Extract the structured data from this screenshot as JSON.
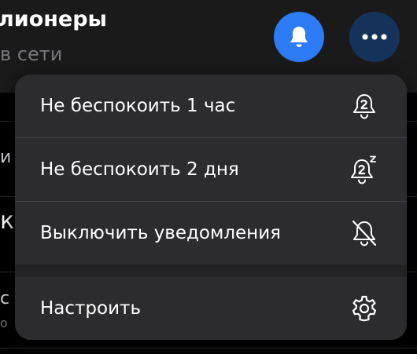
{
  "header": {
    "title": "лионеры",
    "subtitle": "в сети",
    "bell_icon": "bell-icon",
    "more_icon": "ellipsis-icon",
    "bell_button_color": "#2d7cf5",
    "more_button_color": "#15335a"
  },
  "background_list": {
    "fragments": [
      "и",
      "к",
      "с",
      "о"
    ]
  },
  "menu": {
    "items": [
      {
        "label": "Не беспокоить 1 час",
        "icon": "bell-1h-icon"
      },
      {
        "label": "Не беспокоить 2 дня",
        "icon": "bell-2d-snooze-icon"
      },
      {
        "label": "Выключить уведомления",
        "icon": "bell-off-icon"
      },
      {
        "label": "Настроить",
        "icon": "gear-icon"
      }
    ]
  }
}
